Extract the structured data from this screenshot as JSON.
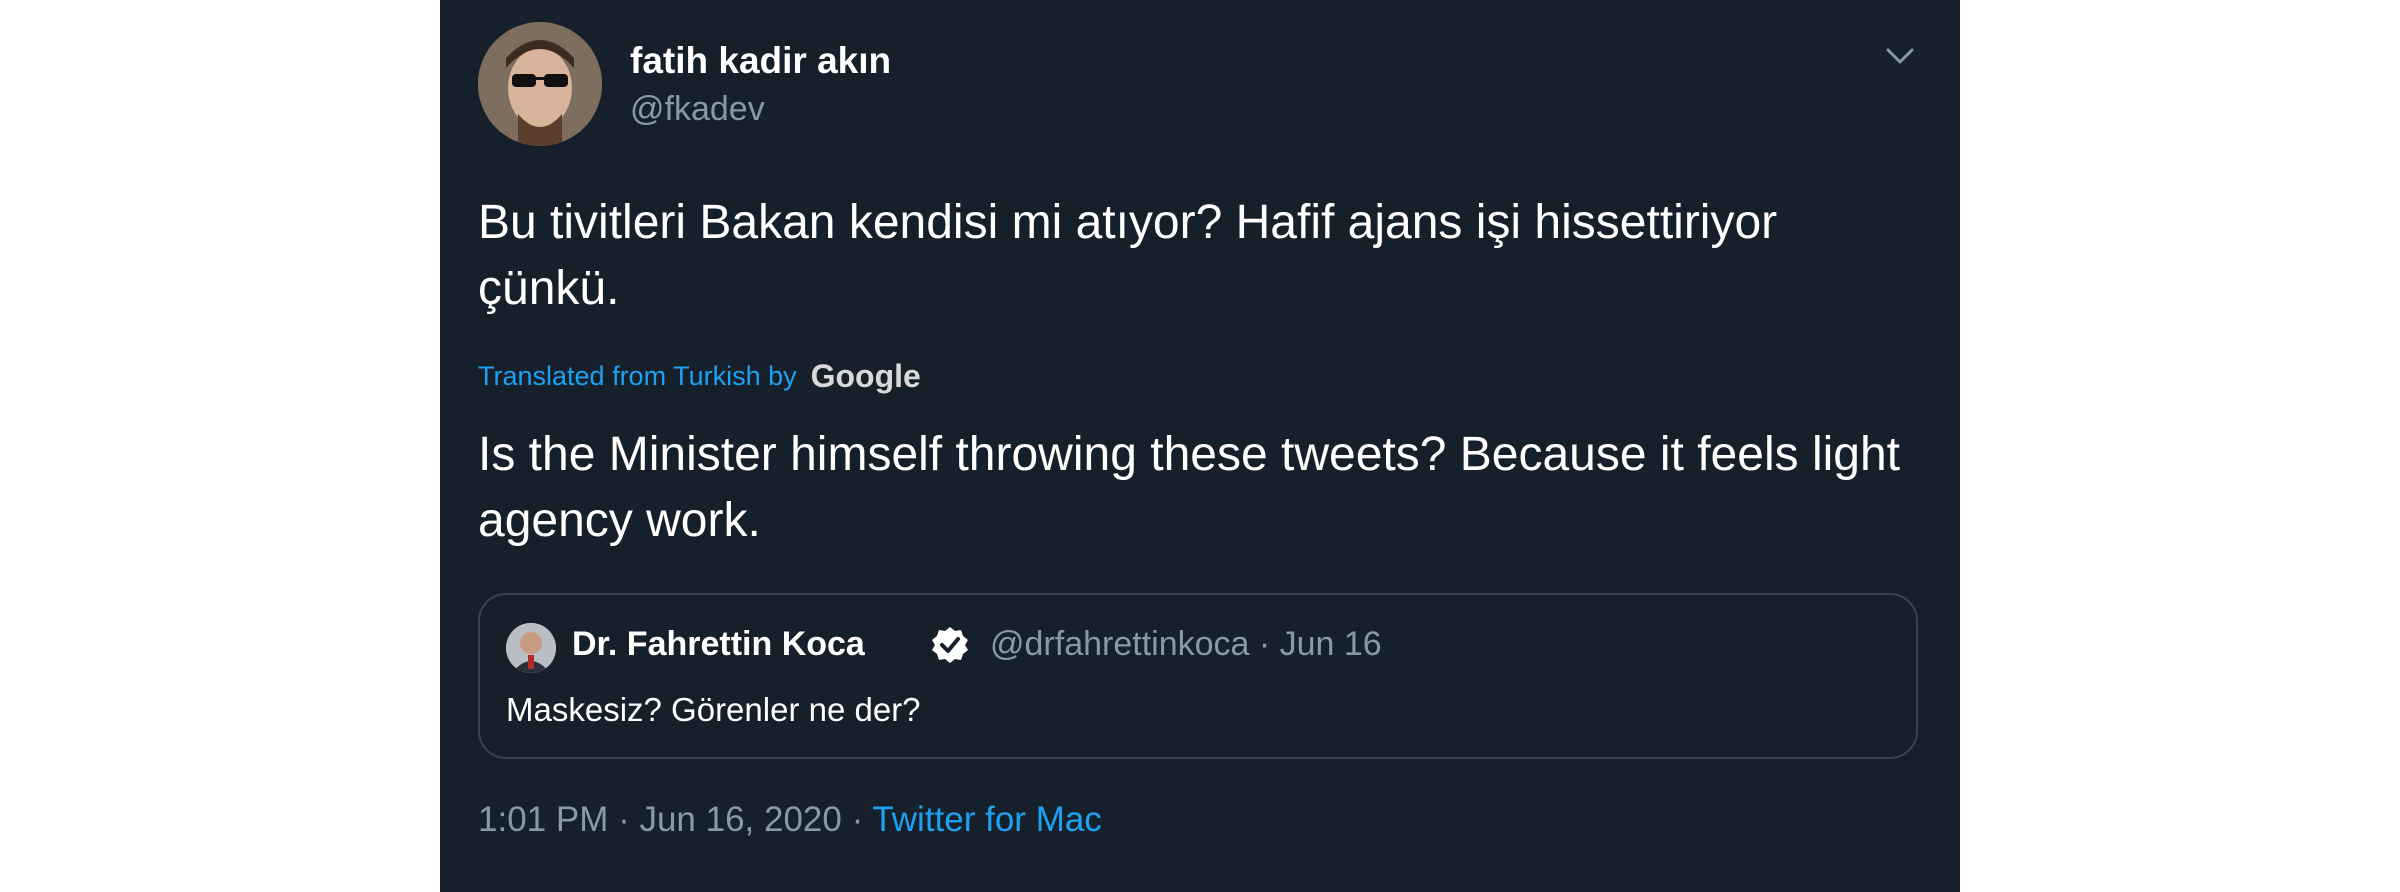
{
  "tweet": {
    "author_name": "fatih kadir akın",
    "author_handle": "@fkadev",
    "original_text": "Bu tivitleri Bakan kendisi mi atıyor? Hafif ajans işi hissettiriyor çünkü.",
    "translation_label": "Translated from Turkish by",
    "translation_provider": "Google",
    "translated_text": "Is the Minister himself throwing these tweets? Because it feels light agency work.",
    "time": "1:01 PM · Jun 16, 2020 · ",
    "source": "Twitter for Mac"
  },
  "quoted": {
    "author_name": "Dr. Fahrettin Koca",
    "meta": "@drfahrettinkoca · Jun 16",
    "text": "Maskesiz? Görenler ne der?"
  },
  "icons": {
    "caret": "chevron-down-icon",
    "verified": "verified-badge-icon"
  },
  "colors": {
    "background": "#15202b",
    "accent": "#1da1f2",
    "secondary_text": "#8899a6",
    "border": "#38444d"
  }
}
